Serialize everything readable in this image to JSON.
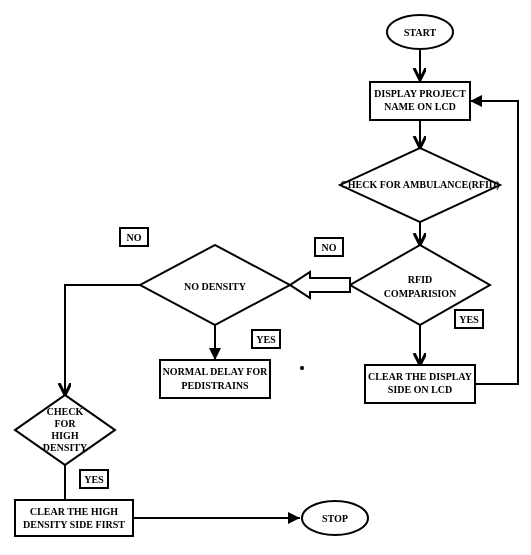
{
  "chart_data": {
    "type": "flowchart",
    "nodes": [
      {
        "id": "start",
        "kind": "terminator",
        "text": "START"
      },
      {
        "id": "display",
        "kind": "process",
        "text": "DISPLAY PROJECT NAME ON LCD"
      },
      {
        "id": "check_amb",
        "kind": "decision",
        "text": "CHECK FOR AMBULANCE(RFID)"
      },
      {
        "id": "rfid",
        "kind": "decision",
        "text": "RFID COMPARISION"
      },
      {
        "id": "clear_disp",
        "kind": "process",
        "text": "CLEAR THE DISPLAY SIDE ON LCD"
      },
      {
        "id": "density",
        "kind": "decision",
        "text": "NO   DENSITY"
      },
      {
        "id": "normal_delay",
        "kind": "process",
        "text": "NORMAL DELAY FOR PEDISTRAINS"
      },
      {
        "id": "high_density",
        "kind": "decision",
        "text": "CHECK FOR HIGH DENSITY"
      },
      {
        "id": "clear_high",
        "kind": "process",
        "text": "CLEAR THE HIGH DENSITY SIDE FIRST"
      },
      {
        "id": "stop",
        "kind": "terminator",
        "text": "STOP"
      }
    ],
    "edges": [
      {
        "from": "start",
        "to": "display"
      },
      {
        "from": "display",
        "to": "check_amb"
      },
      {
        "from": "check_amb",
        "to": "rfid"
      },
      {
        "from": "rfid",
        "to": "clear_disp",
        "label": "YES"
      },
      {
        "from": "rfid",
        "to": "density",
        "label": "NO"
      },
      {
        "from": "density",
        "to": "normal_delay",
        "label": "YES"
      },
      {
        "from": "density",
        "to": "high_density",
        "label": "NO"
      },
      {
        "from": "high_density",
        "to": "clear_high",
        "label": "YES"
      },
      {
        "from": "clear_high",
        "to": "stop"
      },
      {
        "from": "clear_disp",
        "to": "display",
        "note": "feedback loop"
      }
    ]
  },
  "nodes": {
    "start": "START",
    "display_l1": "DISPLAY PROJECT",
    "display_l2": "NAME ON LCD",
    "check_amb": "CHECK FOR AMBULANCE(RFID)",
    "rfid_l1": "RFID",
    "rfid_l2": "COMPARISION",
    "clear_disp_l1": "CLEAR THE DISPLAY",
    "clear_disp_l2": "SIDE ON LCD",
    "density": "NO   DENSITY",
    "normal_l1": "NORMAL DELAY FOR",
    "normal_l2": "PEDISTRAINS",
    "hd_l1": "CHECK",
    "hd_l2": "FOR",
    "hd_l3": "HIGH",
    "hd_l4": "DENSITY",
    "clear_high_l1": "CLEAR THE HIGH",
    "clear_high_l2": "DENSITY SIDE FIRST",
    "stop": "STOP"
  },
  "labels": {
    "no1": "NO",
    "no2": "NO",
    "yes1": "YES",
    "yes2": "YES",
    "yes3": "YES"
  }
}
